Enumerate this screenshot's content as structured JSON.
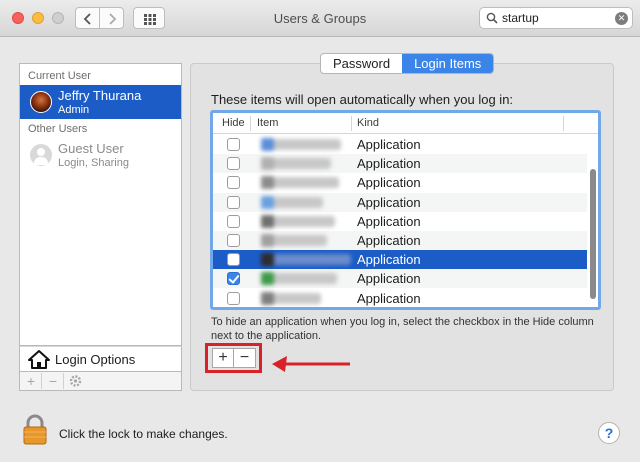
{
  "window": {
    "title": "Users & Groups"
  },
  "search": {
    "value": "startup",
    "clear_icon": "clear-icon"
  },
  "sidebar": {
    "current_user_header": "Current User",
    "other_users_header": "Other Users",
    "current_user": {
      "name": "Jeffry Thurana",
      "role": "Admin"
    },
    "guest_user": {
      "name": "Guest User",
      "role": "Login, Sharing"
    },
    "login_options_label": "Login Options",
    "buttons": {
      "add": "+",
      "remove": "−"
    }
  },
  "tabs": [
    "Password",
    "Login Items"
  ],
  "login_items": {
    "heading": "These items will open automatically when you log in:",
    "columns": {
      "hide": "Hide",
      "item": "Item",
      "kind": "Kind"
    },
    "rows": [
      {
        "kind": "Application",
        "hide": false,
        "selected": false
      },
      {
        "kind": "Application",
        "hide": false,
        "selected": false
      },
      {
        "kind": "Application",
        "hide": false,
        "selected": false
      },
      {
        "kind": "Application",
        "hide": false,
        "selected": false
      },
      {
        "kind": "Application",
        "hide": false,
        "selected": false
      },
      {
        "kind": "Application",
        "hide": false,
        "selected": false
      },
      {
        "kind": "Application",
        "hide": false,
        "selected": true
      },
      {
        "kind": "Application",
        "hide": true,
        "selected": false
      },
      {
        "kind": "Application",
        "hide": false,
        "selected": false
      }
    ],
    "hint": "To hide an application when you log in, select the checkbox in the Hide column next to the application.",
    "add_label": "+",
    "remove_label": "−"
  },
  "footer": {
    "lock_text": "Click the lock to make changes.",
    "help_label": "?"
  },
  "colors": {
    "accent": "#1b5cc7",
    "annotation_red": "#d7222a"
  }
}
